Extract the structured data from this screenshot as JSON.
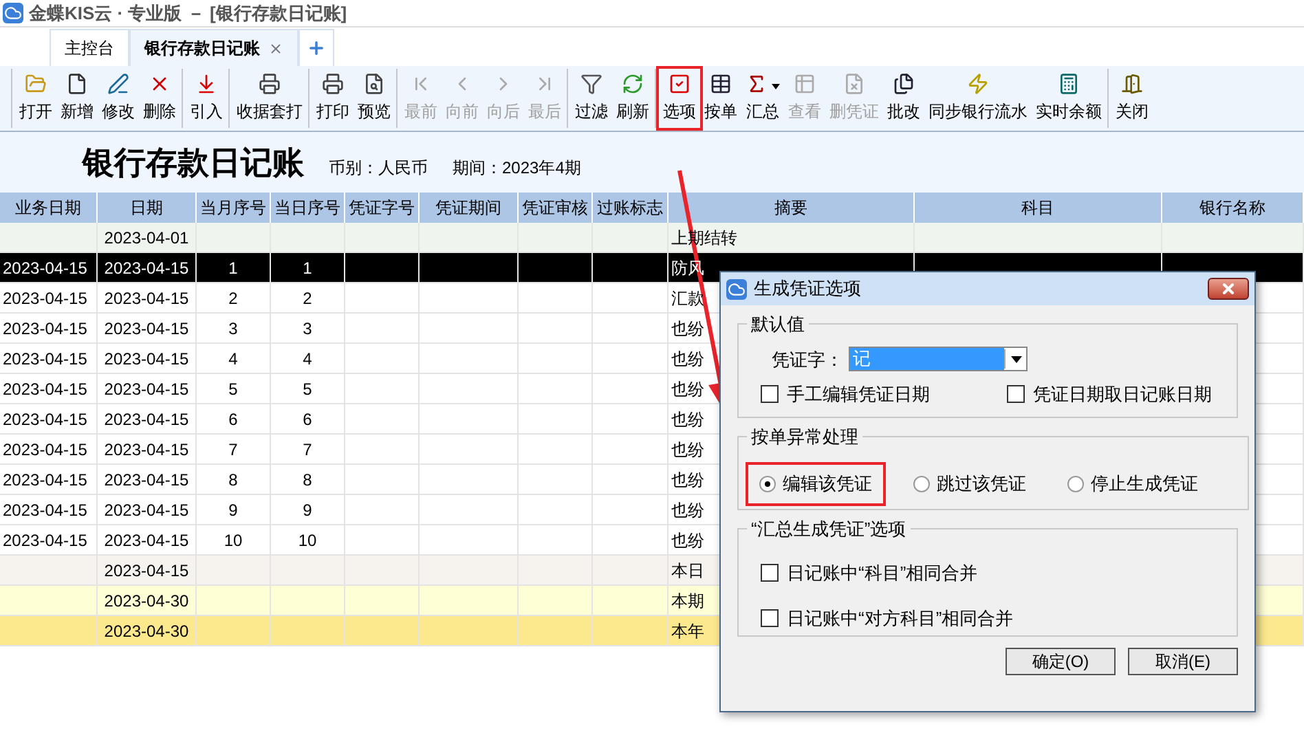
{
  "window": {
    "title": "金蝶KIS云 · 专业版 － [银行存款日记账]"
  },
  "tabs": [
    {
      "label": "主控台",
      "selected": false,
      "closable": false
    },
    {
      "label": "银行存款日记账",
      "selected": true,
      "closable": true
    }
  ],
  "toolbar": {
    "groups": [
      [
        {
          "label": "打开",
          "disabled": false,
          "highlighted": false,
          "dropdown": false
        },
        {
          "label": "新增",
          "disabled": false,
          "highlighted": false,
          "dropdown": false
        },
        {
          "label": "修改",
          "disabled": false,
          "highlighted": false,
          "dropdown": false
        },
        {
          "label": "删除",
          "disabled": false,
          "highlighted": false,
          "dropdown": false
        }
      ],
      [
        {
          "label": "引入",
          "disabled": false,
          "highlighted": false,
          "dropdown": false
        }
      ],
      [
        {
          "label": "收据套打",
          "disabled": false,
          "highlighted": false,
          "dropdown": false
        }
      ],
      [
        {
          "label": "打印",
          "disabled": false,
          "highlighted": false,
          "dropdown": false
        },
        {
          "label": "预览",
          "disabled": false,
          "highlighted": false,
          "dropdown": false
        }
      ],
      [
        {
          "label": "最前",
          "disabled": true,
          "highlighted": false,
          "dropdown": false
        },
        {
          "label": "向前",
          "disabled": true,
          "highlighted": false,
          "dropdown": false
        },
        {
          "label": "向后",
          "disabled": true,
          "highlighted": false,
          "dropdown": false
        },
        {
          "label": "最后",
          "disabled": true,
          "highlighted": false,
          "dropdown": false
        }
      ],
      [
        {
          "label": "过滤",
          "disabled": false,
          "highlighted": false,
          "dropdown": false
        },
        {
          "label": "刷新",
          "disabled": false,
          "highlighted": false,
          "dropdown": false
        }
      ],
      [
        {
          "label": "选项",
          "disabled": false,
          "highlighted": true,
          "dropdown": false
        },
        {
          "label": "按单",
          "disabled": false,
          "highlighted": false,
          "dropdown": false
        },
        {
          "label": "汇总",
          "disabled": false,
          "highlighted": false,
          "dropdown": true
        },
        {
          "label": "查看",
          "disabled": true,
          "highlighted": false,
          "dropdown": false
        },
        {
          "label": "删凭证",
          "disabled": true,
          "highlighted": false,
          "dropdown": false
        },
        {
          "label": "批改",
          "disabled": false,
          "highlighted": false,
          "dropdown": false
        },
        {
          "label": "同步银行流水",
          "disabled": false,
          "highlighted": false,
          "dropdown": false
        },
        {
          "label": "实时余额",
          "disabled": false,
          "highlighted": false,
          "dropdown": false
        }
      ],
      [
        {
          "label": "关闭",
          "disabled": false,
          "highlighted": false,
          "dropdown": false
        }
      ]
    ]
  },
  "report": {
    "title": "银行存款日记账",
    "currency": "币别：人民币",
    "period": "期间：2023年4期"
  },
  "table": {
    "columns": [
      "业务日期",
      "日期",
      "当月序号",
      "当日序号",
      "凭证字号",
      "凭证期间",
      "凭证审核",
      "过账标志",
      "摘要",
      "科目",
      "银行名称"
    ],
    "rows": [
      {
        "kind": "opening",
        "selected": false,
        "date": "2023-04-01",
        "summary": "上期结转"
      },
      {
        "selected": true,
        "business_date": "2023-04-15",
        "date": "2023-04-15",
        "month_no": "1",
        "day_no": "1",
        "summary": "防风"
      },
      {
        "kind": "entry",
        "selected": false,
        "business_date": "2023-04-15",
        "date": "2023-04-15",
        "month_no": "2",
        "day_no": "2",
        "summary": "汇款"
      },
      {
        "kind": "entry",
        "selected": false,
        "business_date": "2023-04-15",
        "date": "2023-04-15",
        "month_no": "3",
        "day_no": "3",
        "summary": "也纷"
      },
      {
        "kind": "entry",
        "selected": false,
        "business_date": "2023-04-15",
        "date": "2023-04-15",
        "month_no": "4",
        "day_no": "4",
        "summary": "也纷"
      },
      {
        "kind": "entry",
        "selected": false,
        "business_date": "2023-04-15",
        "date": "2023-04-15",
        "month_no": "5",
        "day_no": "5",
        "summary": "也纷"
      },
      {
        "kind": "entry",
        "selected": false,
        "business_date": "2023-04-15",
        "date": "2023-04-15",
        "month_no": "6",
        "day_no": "6",
        "summary": "也纷"
      },
      {
        "kind": "entry",
        "selected": false,
        "business_date": "2023-04-15",
        "date": "2023-04-15",
        "month_no": "7",
        "day_no": "7",
        "summary": "也纷"
      },
      {
        "kind": "entry",
        "selected": false,
        "business_date": "2023-04-15",
        "date": "2023-04-15",
        "month_no": "8",
        "day_no": "8",
        "summary": "也纷"
      },
      {
        "kind": "entry",
        "selected": false,
        "business_date": "2023-04-15",
        "date": "2023-04-15",
        "month_no": "9",
        "day_no": "9",
        "summary": "也纷"
      },
      {
        "kind": "entry",
        "selected": false,
        "business_date": "2023-04-15",
        "date": "2023-04-15",
        "month_no": "10",
        "day_no": "10",
        "summary": "也纷"
      },
      {
        "kind": "day_total",
        "selected": false,
        "date": "2023-04-15",
        "summary": "本日"
      },
      {
        "kind": "period_total",
        "selected": false,
        "date": "2023-04-30",
        "summary": "本期"
      },
      {
        "kind": "year_total",
        "selected": false,
        "date": "2023-04-30",
        "summary": "本年"
      }
    ]
  },
  "dialog": {
    "title": "生成凭证选项",
    "defaults": {
      "legend": "默认值",
      "voucher_word": {
        "label": "凭证字：",
        "value": "记"
      },
      "checkboxes": [
        {
          "label": "手工编辑凭证日期",
          "checked": false
        },
        {
          "label": "凭证日期取日记账日期",
          "checked": false
        }
      ]
    },
    "exception": {
      "legend": "按单异常处理",
      "options": [
        {
          "label": "编辑该凭证",
          "selected": true,
          "highlighted": true
        },
        {
          "label": "跳过该凭证",
          "selected": false,
          "highlighted": false
        },
        {
          "label": "停止生成凭证",
          "selected": false,
          "highlighted": false
        }
      ]
    },
    "summary": {
      "legend": "“汇总生成凭证”选项",
      "checkboxes": [
        {
          "label": "日记账中“科目”相同合并",
          "checked": false
        },
        {
          "label": "日记账中“对方科目”相同合并",
          "checked": false
        }
      ]
    },
    "buttons": [
      "确定(O)",
      "取消(E)"
    ]
  }
}
